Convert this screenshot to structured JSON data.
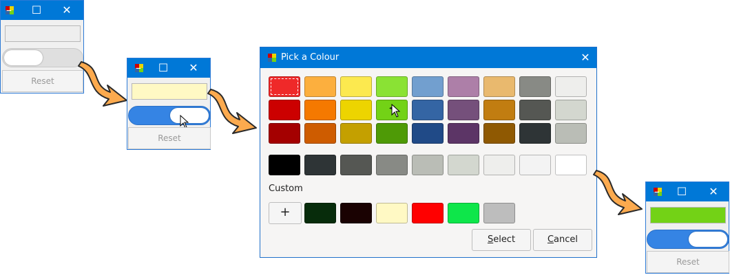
{
  "window1": {
    "reset_label": "Reset"
  },
  "window2": {
    "reset_label": "Reset",
    "entry_color": "#fff9c4"
  },
  "window3": {
    "reset_label": "Reset",
    "entry_color": "#73d216"
  },
  "dialog": {
    "title": "Pick a Colour",
    "custom_label": "Custom",
    "add_label": "+",
    "select_label": "Select",
    "cancel_label": "Cancel",
    "palette": [
      [
        "#ef2929",
        "#fcaf3e",
        "#fce94f",
        "#8ae234",
        "#729fcf",
        "#ad7fa8",
        "#e9b96e",
        "#888a85",
        "#eeeeec"
      ],
      [
        "#cc0000",
        "#f57900",
        "#edd400",
        "#73d216",
        "#3465a4",
        "#75507b",
        "#c17d11",
        "#555753",
        "#d3d7cf"
      ],
      [
        "#a40000",
        "#ce5c00",
        "#c4a000",
        "#4e9a06",
        "#204a87",
        "#5c3566",
        "#8f5902",
        "#2e3436",
        "#babdb6"
      ]
    ],
    "grays": [
      "#000000",
      "#2e3436",
      "#555753",
      "#888a85",
      "#babdb6",
      "#d3d7cf",
      "#eeeeec",
      "#f3f3f3",
      "#ffffff"
    ],
    "custom_colors": [
      "#072c0b",
      "#1a0202",
      "#fff9c4",
      "#ff0000",
      "#0ee64a",
      "#bdbdbd"
    ],
    "selected_color": "#73d216"
  }
}
